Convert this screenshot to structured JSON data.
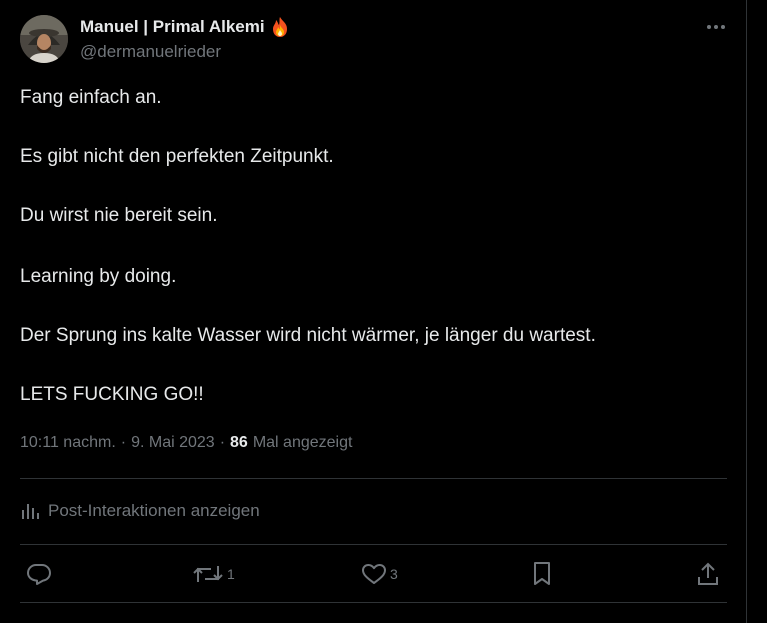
{
  "author": {
    "display_name": "Manuel | Primal Alkemi",
    "handle": "@dermanuelrieder",
    "name_emoji": "fire-icon"
  },
  "tweet": {
    "lines": [
      "Fang einfach an.",
      "Es gibt nicht den perfekten Zeitpunkt.",
      "Du wirst nie bereit sein.",
      "Learning by doing.",
      "Der Sprung ins kalte Wasser wird nicht wärmer, je länger du wartest.",
      "LETS FUCKING GO!!"
    ]
  },
  "meta": {
    "time": "10:11 nachm.",
    "separator": "·",
    "date": "9. Mai 2023",
    "views_count": "86",
    "views_label": "Mal angezeigt"
  },
  "analytics": {
    "label": "Post-Interaktionen anzeigen",
    "icon": "analytics-icon"
  },
  "actions": {
    "reply": {
      "icon": "reply-icon",
      "count": ""
    },
    "repost": {
      "icon": "repost-icon",
      "count": "1"
    },
    "like": {
      "icon": "heart-icon",
      "count": "3"
    },
    "bookmark": {
      "icon": "bookmark-icon",
      "count": ""
    },
    "share": {
      "icon": "share-icon",
      "count": ""
    }
  },
  "colors": {
    "background": "#000000",
    "text_primary": "#e7e9ea",
    "text_secondary": "#71767b",
    "divider": "#2f3336"
  }
}
